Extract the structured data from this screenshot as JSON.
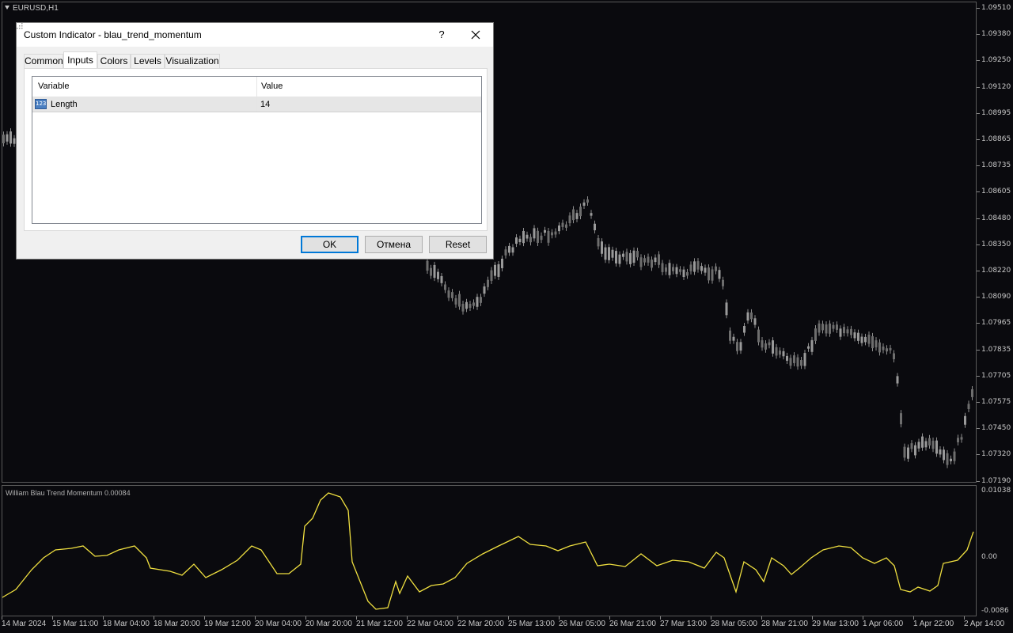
{
  "chart": {
    "symbol": "EURUSD,H1",
    "indicator_label": "William Blau Trend Momentum 0.00084",
    "price_axis": [
      "1.09510",
      "1.09380",
      "1.09250",
      "1.09120",
      "1.08995",
      "1.08865",
      "1.08735",
      "1.08605",
      "1.08480",
      "1.08350",
      "1.08220",
      "1.08090",
      "1.07965",
      "1.07835",
      "1.07705",
      "1.07575",
      "1.07450",
      "1.07320",
      "1.07190"
    ],
    "indicator_axis": [
      "0.01038",
      "0.00",
      "-0.0086"
    ],
    "time_axis": [
      "14 Mar 2024",
      "15 Mar 11:00",
      "18 Mar 04:00",
      "18 Mar 20:00",
      "19 Mar 12:00",
      "20 Mar 04:00",
      "20 Mar 20:00",
      "21 Mar 12:00",
      "22 Mar 04:00",
      "22 Mar 20:00",
      "25 Mar 13:00",
      "26 Mar 05:00",
      "26 Mar 21:00",
      "27 Mar 13:00",
      "28 Mar 05:00",
      "28 Mar 21:00",
      "29 Mar 13:00",
      "1 Apr 06:00",
      "1 Apr 22:00",
      "2 Apr 14:00"
    ],
    "colors": {
      "background": "#0a0a0e",
      "candles": "#8c8c8c",
      "indicator_line": "#f0e040",
      "grid_border": "#5a5a5a",
      "axis_text": "#c8c8c8"
    }
  },
  "dialog": {
    "title": "Custom Indicator - blau_trend_momentum",
    "help_label": "?",
    "tabs": [
      {
        "label": "Common"
      },
      {
        "label": "Inputs"
      },
      {
        "label": "Colors"
      },
      {
        "label": "Levels"
      },
      {
        "label": "Visualization"
      }
    ],
    "active_tab": "Inputs",
    "table": {
      "headers": [
        "Variable",
        "Value"
      ],
      "rows": [
        {
          "icon": "integer-type-icon",
          "icon_text": "123",
          "variable": "Length",
          "value": "14"
        }
      ]
    },
    "buttons": {
      "ok": "OK",
      "cancel": "Отмена",
      "reset": "Reset"
    }
  }
}
